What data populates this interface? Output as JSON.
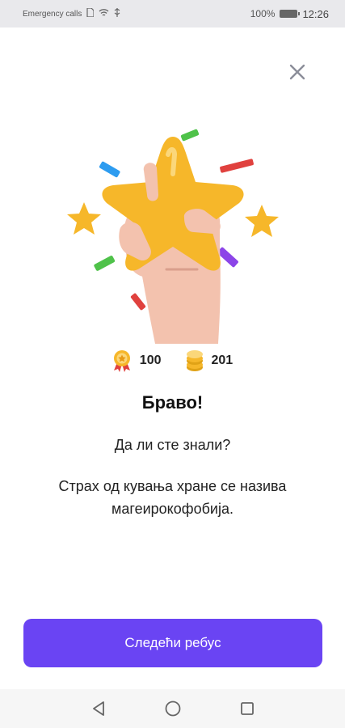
{
  "status_bar": {
    "carrier": "Emergency calls",
    "battery": "100%",
    "time": "12:26"
  },
  "icons": {
    "close": "close-icon",
    "medal": "medal-icon",
    "coins": "coins-icon",
    "back": "back-triangle-icon",
    "home": "home-circle-icon",
    "recents": "recents-square-icon"
  },
  "stats": {
    "points": "100",
    "coins": "201"
  },
  "result": {
    "title": "Браво!",
    "question": "Да ли сте знали?",
    "fact": "Страх од кувања хране се назива магеирокофобија."
  },
  "actions": {
    "next_label": "Следећи ребус"
  },
  "colors": {
    "accent": "#6a44f3",
    "star": "#f6b72a",
    "hand": "#f3c2ae"
  }
}
